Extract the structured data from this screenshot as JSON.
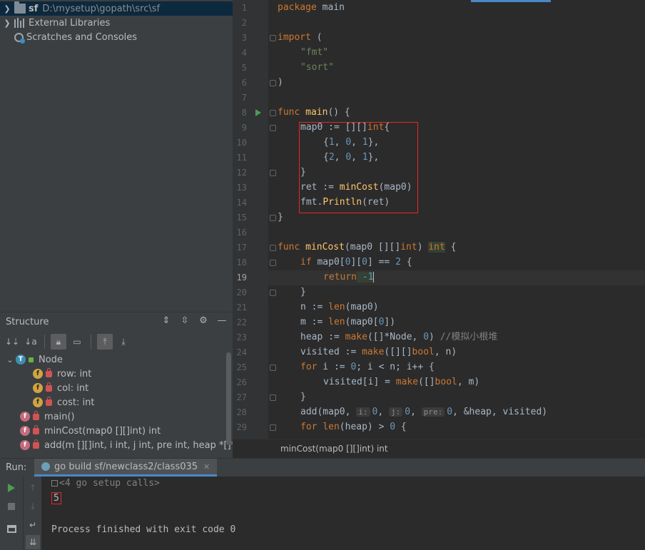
{
  "project_tree": {
    "items": [
      {
        "name": "sf",
        "path": "D:\\mysetup\\gopath\\src\\sf"
      },
      {
        "name": "External Libraries"
      },
      {
        "name": "Scratches and Consoles"
      }
    ]
  },
  "structure": {
    "title": "Structure",
    "items": [
      {
        "label": "Node",
        "badge": "T"
      },
      {
        "label": "row: int",
        "badge": "f"
      },
      {
        "label": "col: int",
        "badge": "f"
      },
      {
        "label": "cost: int",
        "badge": "f"
      },
      {
        "label": "main()",
        "badge": "f"
      },
      {
        "label": "minCost(map0 [][]int) int",
        "badge": "f"
      },
      {
        "label": "add(m [][]int, i int, j int, pre int, heap *[]*Node",
        "badge": "f"
      }
    ]
  },
  "editor": {
    "line_numbers": [
      "1",
      "2",
      "3",
      "4",
      "5",
      "6",
      "7",
      "8",
      "9",
      "10",
      "11",
      "12",
      "13",
      "14",
      "15",
      "16",
      "17",
      "18",
      "19",
      "20",
      "21",
      "22",
      "23",
      "24",
      "25",
      "26",
      "27",
      "28",
      "29"
    ],
    "current_line": "19",
    "code": {
      "l1_kw": "package",
      "l1_name": " main",
      "l3_kw": "import",
      "l3_rest": " (",
      "l4_str": "\"fmt\"",
      "l5_str": "\"sort\"",
      "l6": ")",
      "l8_kw": "func",
      "l8_fn": " main",
      "l8_rest": "() {",
      "l9_a": "map0 := [][]",
      "l9_t": "int",
      "l9_b": "{",
      "l10_a": "{",
      "l10_n1": "1",
      "l10_c1": ", ",
      "l10_n2": "0",
      "l10_c2": ", ",
      "l10_n3": "1",
      "l10_b": "},",
      "l11_a": "{",
      "l11_n1": "2",
      "l11_c1": ", ",
      "l11_n2": "0",
      "l11_c2": ", ",
      "l11_n3": "1",
      "l11_b": "},",
      "l12": "}",
      "l13_a": "ret := ",
      "l13_fn": "minCost",
      "l13_b": "(map0)",
      "l14_a": "fmt.",
      "l14_fn": "Println",
      "l14_b": "(ret)",
      "l15": "}",
      "l17_kw": "func",
      "l17_fn": " minCost",
      "l17_a": "(map0 [][]",
      "l17_t1": "int",
      "l17_b": ") ",
      "l17_t2": "int",
      "l17_c": " {",
      "l18_kw": "if",
      "l18_a": " map0[",
      "l18_n1": "0",
      "l18_b": "][",
      "l18_n2": "0",
      "l18_c": "] == ",
      "l18_n3": "2",
      "l18_d": " {",
      "l19_kw": "return",
      "l19_n": " -1",
      "l20": "}",
      "l21_a": "n := ",
      "l21_fn": "len",
      "l21_b": "(map0)",
      "l22_a": "m := ",
      "l22_fn": "len",
      "l22_b": "(map0[",
      "l22_n": "0",
      "l22_c": "])",
      "l23_a": "heap := ",
      "l23_fn": "make",
      "l23_b": "([]*Node, ",
      "l23_n": "0",
      "l23_c": ") ",
      "l23_cmt": "//模拟小根堆",
      "l24_a": "visited := ",
      "l24_fn": "make",
      "l24_b": "([][]",
      "l24_t": "bool",
      "l24_c": ", n)",
      "l25_kw": "for",
      "l25_a": " i := ",
      "l25_n": "0",
      "l25_b": "; i < n; i++ {",
      "l26_a": "visited[i] = ",
      "l26_fn": "make",
      "l26_b": "([]",
      "l26_t": "bool",
      "l26_c": ", m)",
      "l27": "}",
      "l28_a": "add(map0, ",
      "l28_h1": "i:",
      "l28_n1": "0",
      "l28_c1": ", ",
      "l28_h2": "j:",
      "l28_n2": "0",
      "l28_c2": ", ",
      "l28_h3": "pre:",
      "l28_n3": "0",
      "l28_b": ", &heap, visited)",
      "l29_kw": "for",
      "l29_a": " ",
      "l29_fn": "len",
      "l29_b": "(heap) > ",
      "l29_n": "0",
      "l29_c": " {"
    }
  },
  "breadcrumb": "minCost(map0 [][]int) int",
  "run": {
    "label": "Run:",
    "tab": "go build sf/newclass2/class035",
    "setup_calls": "<4 go setup calls>",
    "output": "5",
    "finished": "Process finished with exit code 0"
  },
  "colors": {
    "keyword": "#cc7832",
    "function": "#ffc66d",
    "string": "#6a8759",
    "number": "#6897bb",
    "highlight_box": "#e8262a"
  }
}
